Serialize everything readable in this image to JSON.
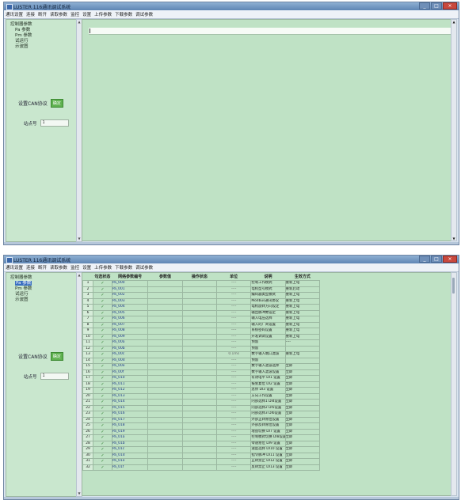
{
  "window1": {
    "title": "LUSTER 116通讯调试系统",
    "menu": [
      "通讯设置",
      "连接",
      "断开",
      "读取参数",
      "监控",
      "设置",
      "上传参数",
      "下载参数",
      "调试参数"
    ],
    "tree": {
      "root": "控制器参数",
      "items": [
        "Pa 参数",
        "Pm 参数",
        "试运行",
        "示波图"
      ]
    },
    "setting_label": "设置CAN协议",
    "setting_button": "确定",
    "station_label": "站点号",
    "station_value": "1"
  },
  "window2": {
    "title": "LUSTER 116通讯调试系统",
    "menu": [
      "通讯设置",
      "连接",
      "断开",
      "读取参数",
      "监控",
      "设置",
      "上传参数",
      "下载参数",
      "调试参数"
    ],
    "tree": {
      "root": "控制器参数",
      "items": [
        "Pa 参数",
        "Pm 参数",
        "试运行",
        "示波图"
      ]
    },
    "setting_label": "设置CAN协议",
    "setting_button": "确定",
    "station_label": "站点号",
    "station_value": "1",
    "table": {
      "headers": [
        "",
        "勾选状态",
        "网络参数编号",
        "参数值",
        "操作状态",
        "单位",
        "说明",
        "生效方式"
      ],
      "rows": [
        {
          "num": "1",
          "checked": "✓",
          "address": "Pa_000",
          "unit": "----",
          "desc": "控制工作模式",
          "effect": "重新上电"
        },
        {
          "num": "2",
          "checked": "✓",
          "address": "Pa_001",
          "unit": "----",
          "desc": "电机型号模式",
          "effect": "重新启动"
        },
        {
          "num": "3",
          "checked": "✓",
          "address": "Pa_002",
          "unit": "----",
          "desc": "编码器类型模式",
          "effect": "重新上电"
        },
        {
          "num": "4",
          "checked": "✓",
          "address": "Pa_003",
          "unit": "----",
          "desc": "Modbus通讯协议",
          "effect": "重新上电"
        },
        {
          "num": "5",
          "checked": "✓",
          "address": "Pa_004",
          "unit": "----",
          "desc": "电机旋转方向设定",
          "effect": "重新上电"
        },
        {
          "num": "6",
          "checked": "✓",
          "address": "Pa_005",
          "unit": "----",
          "desc": "输出脉冲数设定",
          "effect": "重新上电"
        },
        {
          "num": "7",
          "checked": "✓",
          "address": "Pa_006",
          "unit": "----",
          "desc": "输入电压选择",
          "effect": "重新上电"
        },
        {
          "num": "8",
          "checked": "✓",
          "address": "Pa_007",
          "unit": "----",
          "desc": "输入的厂商设置",
          "effect": "重新上电"
        },
        {
          "num": "9",
          "checked": "✓",
          "address": "Pa_008",
          "unit": "----",
          "desc": "系统密码设置",
          "effect": "重新上电"
        },
        {
          "num": "10",
          "checked": "✓",
          "address": "Pa_009",
          "unit": "----",
          "desc": "开发调试设置",
          "effect": "重新上电"
        },
        {
          "num": "11",
          "checked": "✓",
          "address": "Pa_00a",
          "unit": "----",
          "desc": "预留",
          "effect": "----"
        },
        {
          "num": "12",
          "checked": "✓",
          "address": "Pa_00b",
          "unit": "----",
          "desc": "预留",
          "effect": ""
        },
        {
          "num": "13",
          "checked": "✓",
          "address": "Pa_00c",
          "unit": "0.1ms",
          "desc": "数字输入端口滤波",
          "effect": "重新上电"
        },
        {
          "num": "14",
          "checked": "✓",
          "address": "Pa_00d",
          "unit": "----",
          "desc": "预留",
          "effect": ""
        },
        {
          "num": "15",
          "checked": "✓",
          "address": "Pa_00e",
          "unit": "----",
          "desc": "数字输入滤波选择",
          "effect": "立即"
        },
        {
          "num": "16",
          "checked": "✓",
          "address": "Pa_00f",
          "unit": "----",
          "desc": "数字输入滤波设置",
          "effect": "立即"
        },
        {
          "num": "17",
          "checked": "✓",
          "address": "Pa_010",
          "unit": "----",
          "desc": "有效电平 DI1 设置",
          "effect": "立即"
        },
        {
          "num": "18",
          "checked": "✓",
          "address": "Pa_011",
          "unit": "----",
          "desc": "报警复位 DI2 设置",
          "effect": "立即"
        },
        {
          "num": "19",
          "checked": "✓",
          "address": "Pa_012",
          "unit": "----",
          "desc": "急停 DI3 设置",
          "effect": "立即"
        },
        {
          "num": "20",
          "checked": "✓",
          "address": "Pa_013",
          "unit": "----",
          "desc": "方向工作设置",
          "effect": "立即"
        },
        {
          "num": "21",
          "checked": "✓",
          "address": "Pa_014",
          "unit": "----",
          "desc": "内部选择1 DI4设置",
          "effect": "立即"
        },
        {
          "num": "22",
          "checked": "✓",
          "address": "Pa_015",
          "unit": "----",
          "desc": "内部选择2 DI5设置",
          "effect": "立即"
        },
        {
          "num": "23",
          "checked": "✓",
          "address": "Pa_016",
          "unit": "----",
          "desc": "内部选择3 DI6设置",
          "effect": "立即"
        },
        {
          "num": "24",
          "checked": "✓",
          "address": "Pa_017",
          "unit": "----",
          "desc": "外部正转限位设置",
          "effect": "立即"
        },
        {
          "num": "25",
          "checked": "✓",
          "address": "Pa_018",
          "unit": "----",
          "desc": "外部反转限位设置",
          "effect": "立即"
        },
        {
          "num": "26",
          "checked": "✓",
          "address": "Pa_019",
          "unit": "----",
          "desc": "增益切换 DI7 设置",
          "effect": "立即"
        },
        {
          "num": "27",
          "checked": "✓",
          "address": "Pa_01a",
          "unit": "----",
          "desc": "控制模式切换 DI8设置",
          "effect": "立即"
        },
        {
          "num": "28",
          "checked": "✓",
          "address": "Pa_01b",
          "unit": "----",
          "desc": "零速箝位 DI9 设置",
          "effect": "立即"
        },
        {
          "num": "29",
          "checked": "✓",
          "address": "Pa_01c",
          "unit": "----",
          "desc": "速度选择 DI10 设置",
          "effect": "立即"
        },
        {
          "num": "30",
          "checked": "✓",
          "address": "Pa_01d",
          "unit": "----",
          "desc": "指令脉冲 DI11 设置",
          "effect": "立即"
        },
        {
          "num": "31",
          "checked": "✓",
          "address": "Pa_01e",
          "unit": "----",
          "desc": "正转禁止 DI12 设置",
          "effect": "立即"
        },
        {
          "num": "32",
          "checked": "✓",
          "address": "Pa_01f",
          "unit": "----",
          "desc": "反转禁止 DI13 设置",
          "effect": "立即"
        }
      ]
    }
  },
  "colors": {
    "panel": "#c9e7ce",
    "content": "#bfe2c5",
    "titlebar": "#5f86b4",
    "button": "#5fb14f"
  },
  "icons": {
    "minimize": "minimize-icon",
    "maximize": "maximize-icon",
    "close": "close-icon",
    "app": "app-icon",
    "check": "checkmark-icon"
  }
}
